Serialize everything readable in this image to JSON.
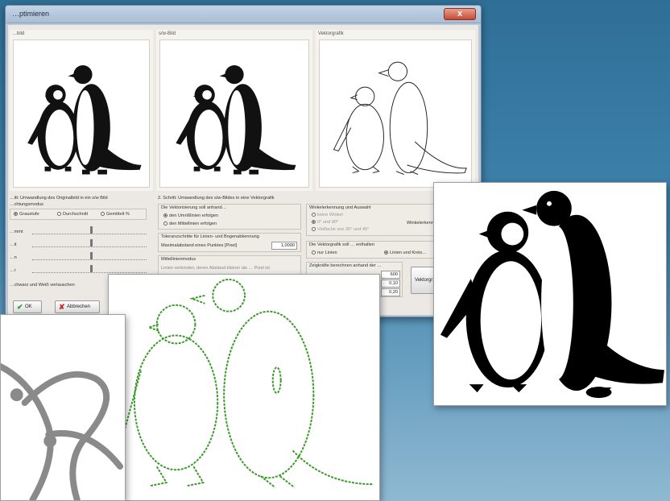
{
  "window": {
    "title": "…ptimieren",
    "close_label": "x"
  },
  "panels": [
    {
      "label": "…bild"
    },
    {
      "label": "s/w-Bild"
    },
    {
      "label": "Vektorgrafik"
    }
  ],
  "step1": {
    "heading": "…itt: Umwandlung des Originalbild in ein s/w Bild",
    "mode_label": "…chtungsmodus",
    "modes": [
      "Graustufe",
      "Durchschnitt",
      "Gemittelt %"
    ],
    "selected_mode": 0,
    "slider_labels": [
      "…mmt",
      "…it",
      "…n",
      "…r"
    ],
    "swap_label": "…chwarz und Weiß vertauschen"
  },
  "step2": {
    "heading": "2. Schritt: Umwandlung des s/w-Bildes in eine Vektorgrafik",
    "vector_group_title": "Die Vektorisierung soll anhand…",
    "vector_options": [
      "den Umrißlinien erfolgen",
      "den Mittellinien erfolgen"
    ],
    "vector_selected": 0,
    "tolerance_title": "Toleranzschritte für Linien- und Bogenabkennung",
    "max_distance_label": "Maximalabstand eines Punktes [Pixel]",
    "max_distance_value": "1,0000",
    "mid_mode_title": "Mittellinienmodus",
    "mid_mode_option": "Linien verbinden, deren Abstand kleiner als … Pixel ist"
  },
  "step3": {
    "angle_title": "Winkelerkennung und Auswahl",
    "angle_options": [
      "keine Winkel",
      "0° und 90°",
      "Vielfache von 30° und 45°"
    ],
    "angle_selected": 1,
    "angle_side_label": "Winkelerkenn…",
    "content_title": "Die Vektorgrafik soll … enthalten",
    "content_options": [
      "nur Linien",
      "Linien und Kreis…"
    ],
    "content_selected": 1,
    "line_title": "Zeigkräfte berechnen anhand der …",
    "values": [
      "600",
      "0,10",
      "0,20"
    ],
    "vector_button": "Vektorgr…"
  },
  "buttons": {
    "ok": "OK",
    "cancel": "Abbrechen"
  },
  "colors": {
    "window_frame": "#b8c8d8",
    "close_button": "#c84a33",
    "outline_green": "#3a9a2a",
    "swirl_gray": "#8a8a8a"
  }
}
